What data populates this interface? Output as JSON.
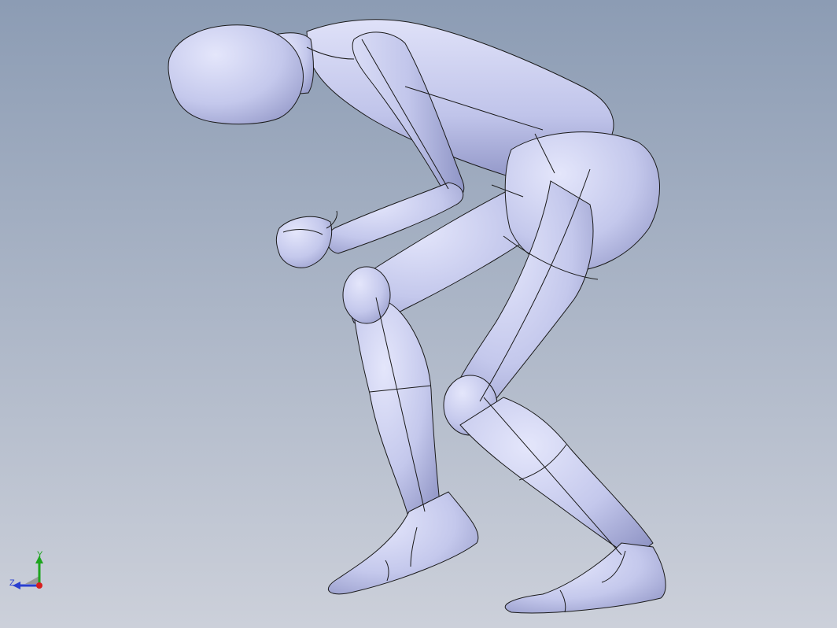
{
  "viewport": {
    "background_top": "#8c9cb4",
    "background_bottom": "#c9ced9",
    "model_fill": "#c6cbed",
    "model_shade": "#8f95c6",
    "edge_color": "#1a1a1a"
  },
  "triad": {
    "y_label": "Y",
    "z_label": "Z",
    "x_axis_color": "#d81e1e",
    "y_axis_color": "#1ea51e",
    "z_axis_color": "#2a3fd0"
  },
  "icons": {
    "triad": "coordinate-triad-icon"
  }
}
